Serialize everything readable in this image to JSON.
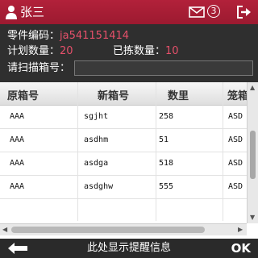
{
  "header": {
    "user_name": "张三",
    "badge_count": "3"
  },
  "info": {
    "part_code_label": "零件编码：",
    "part_code_value": "ja541151414",
    "planned_qty_label": "计划数量：",
    "planned_qty_value": "20",
    "picked_qty_label": "已拣数量：",
    "picked_qty_value": "10",
    "scan_box_label": "请扫描箱号：",
    "scan_box_value": ""
  },
  "table": {
    "columns": [
      "原箱号",
      "新箱号",
      "数里",
      "笼箱号"
    ],
    "rows": [
      [
        "AAA",
        "sgjht",
        "258",
        "ASD"
      ],
      [
        "AAA",
        "asdhm",
        "51",
        "ASD"
      ],
      [
        "AAA",
        "asdga",
        "518",
        "ASD"
      ],
      [
        "AAA",
        "asdghw",
        "555",
        "ASD"
      ]
    ]
  },
  "footer": {
    "message": "此处显示提醒信息",
    "ok_label": "OK"
  },
  "colors": {
    "accent": "#a51d35",
    "value_text": "#e5506a",
    "panel": "#2f2f2f"
  }
}
